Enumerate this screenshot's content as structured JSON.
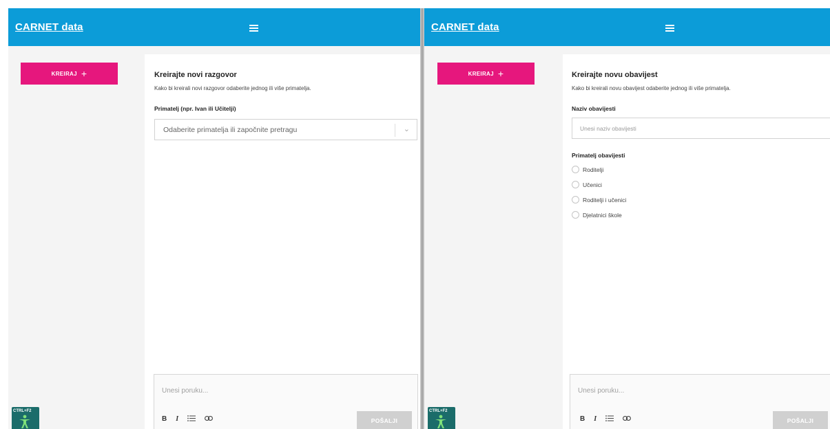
{
  "left": {
    "brand": "CARNET data",
    "create_label": "KREIRAJ",
    "create_plus": "+",
    "title": "Kreirajte novi razgovor",
    "subtitle": "Kako bi kreirali novi razgovor odaberite jednog ili više primatelja.",
    "recipient_label": "Primatelj (npr. Ivan ili Učitelji)",
    "recipient_placeholder": "Odaberite primatelja ili započnite pretragu",
    "message_placeholder": "Unesi poruku...",
    "send_label": "POŠALJI",
    "accessibility_label": "CTRL+F2"
  },
  "right": {
    "brand": "CARNET data",
    "create_label": "KREIRAJ",
    "create_plus": "+",
    "title": "Kreirajte novu obavijest",
    "subtitle": "Kako bi kreirali novu obavijest odaberite jednog ili više primatelja.",
    "name_label": "Naziv obavijesti",
    "name_placeholder": "Unesi naziv obavijesti",
    "recipients_label": "Primatelj obavijesti",
    "recipient_options": [
      "Roditelji",
      "Učenici",
      "Roditelji i učenici",
      "Djelatnici škole"
    ],
    "message_placeholder": "Unesi poruku...",
    "send_label": "POŠALJI",
    "accessibility_label": "CTRL+F2"
  },
  "toolbar": {
    "bold": "B",
    "italic": "I",
    "list_icon": "list-icon",
    "link_icon": "link-icon"
  },
  "colors": {
    "topbar": "#0c9cd8",
    "accent": "#e6177d",
    "send_disabled": "#d0d0d0",
    "accessibility": "#1b6c6a"
  }
}
